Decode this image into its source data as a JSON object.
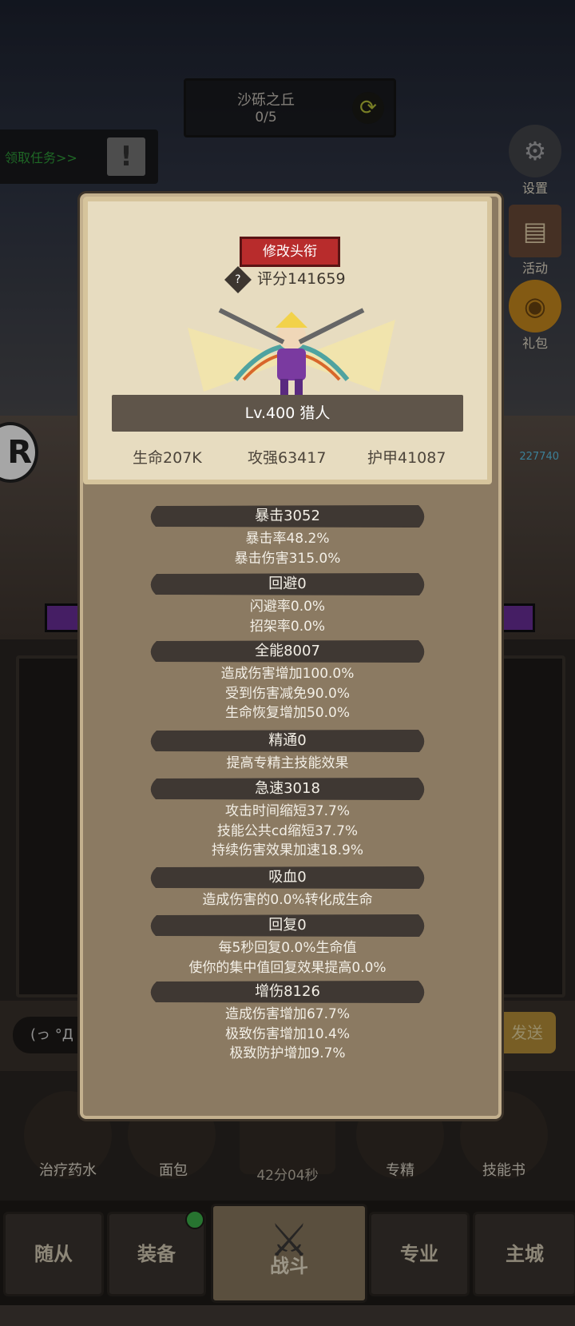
{
  "stage": {
    "name": "沙砾之丘",
    "progress": "0/5"
  },
  "quest": {
    "label": "领取任务>>"
  },
  "side_buttons": [
    {
      "label": "设置",
      "icon": "gear-icon"
    },
    {
      "label": "活动",
      "icon": "scroll-icon"
    },
    {
      "label": "礼包",
      "icon": "giftbag-icon"
    }
  ],
  "enemy_hp": "227740",
  "chat": {
    "input_text": "(っ °Д °",
    "send_label": "发送"
  },
  "items": [
    {
      "label": "治疗药水",
      "icon": "potion-icon"
    },
    {
      "label": "面包",
      "icon": "bread-icon"
    },
    {
      "label": "专精",
      "icon": "target-icon"
    },
    {
      "label": "技能书",
      "icon": "book-icon"
    }
  ],
  "chest_timer": "42分04秒",
  "tabs": [
    {
      "label": "随从"
    },
    {
      "label": "装备"
    },
    {
      "label": "战斗"
    },
    {
      "label": "专业"
    },
    {
      "label": "主城"
    }
  ],
  "profile": {
    "change_title_label": "修改头衔",
    "score": "评分141659",
    "level_class": "Lv.400 猎人",
    "hp": "生命207K",
    "attack": "攻强63417",
    "armor": "护甲41087"
  },
  "stats": [
    {
      "header": "暴击3052",
      "lines": [
        "暴击率48.2%",
        "暴击伤害315.0%"
      ]
    },
    {
      "header": "回避0",
      "lines": [
        "闪避率0.0%",
        "招架率0.0%"
      ]
    },
    {
      "header": "全能8007",
      "lines": [
        "造成伤害增加100.0%",
        "受到伤害减免90.0%",
        "生命恢复增加50.0%"
      ]
    },
    {
      "header": "精通0",
      "lines": [
        "提高专精主技能效果"
      ]
    },
    {
      "header": "急速3018",
      "lines": [
        "攻击时间缩短37.7%",
        "技能公共cd缩短37.7%",
        "持续伤害效果加速18.9%"
      ]
    },
    {
      "header": "吸血0",
      "lines": [
        "造成伤害的0.0%转化成生命"
      ]
    },
    {
      "header": "回复0",
      "lines": [
        "每5秒回复0.0%生命值",
        "使你的集中值回复效果提高0.0%"
      ]
    },
    {
      "header": "增伤8126",
      "lines": [
        "造成伤害增加67.7%",
        "极致伤害增加10.4%",
        "极致防护增加9.7%"
      ]
    }
  ],
  "colors": {
    "title_button": "#b82c2c",
    "panel": "#8b7a62",
    "card": "#e7dcc0",
    "stat_header": "#3f3833"
  }
}
